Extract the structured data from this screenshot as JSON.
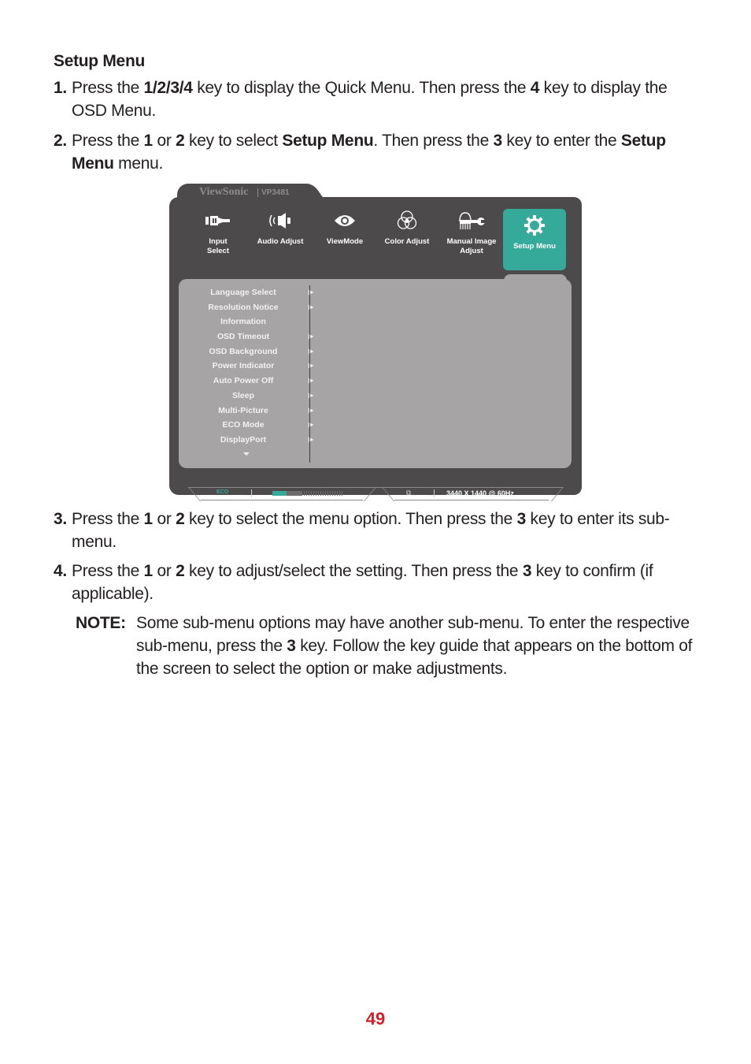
{
  "section_title": "Setup Menu",
  "steps": [
    {
      "num": "1.",
      "parts": [
        "Press the ",
        "1/2/3/4",
        " key to display the Quick Menu. Then press the ",
        "4",
        " key to display the OSD Menu."
      ]
    },
    {
      "num": "2.",
      "parts": [
        "Press the ",
        "1",
        " or ",
        "2",
        " key to select ",
        "Setup Menu",
        ". Then press the ",
        "3",
        " key to enter the ",
        "Setup Menu",
        " menu."
      ]
    },
    {
      "num": "3.",
      "parts": [
        "Press the ",
        "1",
        " or ",
        "2",
        " key to select the menu option. Then press the ",
        "3",
        " key to enter its sub-menu."
      ]
    },
    {
      "num": "4.",
      "parts": [
        "Press the ",
        "1",
        " or ",
        "2",
        " key to adjust/select the setting. Then press the ",
        "3",
        " key to confirm (if applicable)."
      ]
    }
  ],
  "note": {
    "label": "NOTE:",
    "parts": [
      "Some sub-menu options may have another sub-menu. To enter the respective sub-menu, press the ",
      "3",
      " key. Follow the key guide that appears on the bottom of the screen to select the option or make adjustments."
    ]
  },
  "osd": {
    "brand": "ViewSonic",
    "model": "VP3481",
    "accent_color": "#35aa9a",
    "nav": [
      {
        "label": "Input Select",
        "icon": "input-select-icon",
        "active": false
      },
      {
        "label": "Audio Adjust",
        "icon": "speaker-icon",
        "active": false
      },
      {
        "label": "ViewMode",
        "icon": "eye-icon",
        "active": false
      },
      {
        "label": "Color Adjust",
        "icon": "color-circles-icon",
        "active": false
      },
      {
        "label": "Manual Image Adjust",
        "icon": "hand-wrench-icon",
        "active": false
      },
      {
        "label": "Setup Menu",
        "icon": "gear-icon",
        "active": true
      }
    ],
    "menu_items": [
      {
        "label": "Language Select",
        "has_submenu": true
      },
      {
        "label": "Resolution Notice",
        "has_submenu": true
      },
      {
        "label": "Information",
        "has_submenu": false
      },
      {
        "label": "OSD Timeout",
        "has_submenu": true
      },
      {
        "label": "OSD Background",
        "has_submenu": true
      },
      {
        "label": "Power Indicator",
        "has_submenu": true
      },
      {
        "label": "Auto Power Off",
        "has_submenu": true
      },
      {
        "label": "Sleep",
        "has_submenu": true
      },
      {
        "label": "Multi-Picture",
        "has_submenu": true
      },
      {
        "label": "ECO Mode",
        "has_submenu": true
      },
      {
        "label": "DisplayPort",
        "has_submenu": true
      }
    ],
    "arrow_glyph": "▶",
    "status": {
      "eco_label": "ECO",
      "resolution": "3440 X 1440 @ 60Hz"
    }
  },
  "page_number": "49"
}
